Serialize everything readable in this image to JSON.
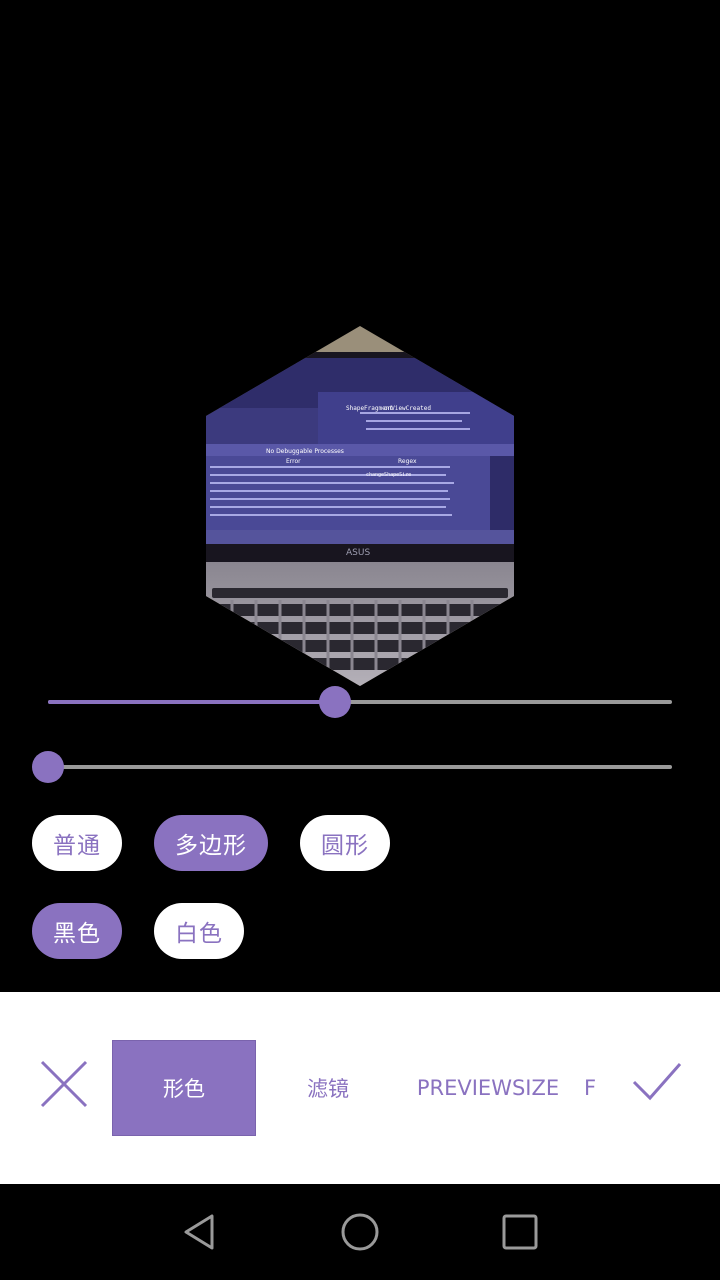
{
  "preview": {
    "shape": "hexagon",
    "scene": "laptop-screen-photo",
    "screen_snippets": [
      "ShapeFragment",
      "onViewCreated",
      "No Debuggable Processes",
      "Error",
      "Regex",
      "changeShapeSize",
      "ASUS"
    ]
  },
  "sliders": [
    {
      "name": "size-slider",
      "value": 0.46
    },
    {
      "name": "rotation-slider",
      "value": 0.0
    }
  ],
  "shape_options": [
    {
      "label": "普通",
      "selected": false
    },
    {
      "label": "多边形",
      "selected": true
    },
    {
      "label": "圆形",
      "selected": false
    }
  ],
  "color_options": [
    {
      "label": "黑色",
      "selected": true
    },
    {
      "label": "白色",
      "selected": false
    }
  ],
  "toolbar": {
    "tabs": [
      "形色",
      "滤镜",
      "PREVIEWSIZE",
      "F"
    ],
    "active_tab": 0,
    "close_icon": "close-icon",
    "confirm_icon": "check-icon"
  },
  "nav": {
    "back_icon": "triangle-back-icon",
    "home_icon": "circle-home-icon",
    "recent_icon": "square-recent-icon"
  },
  "colors": {
    "accent": "#8a72c0",
    "track": "#9a9a9a",
    "background": "#000000",
    "panel": "#ffffff"
  }
}
